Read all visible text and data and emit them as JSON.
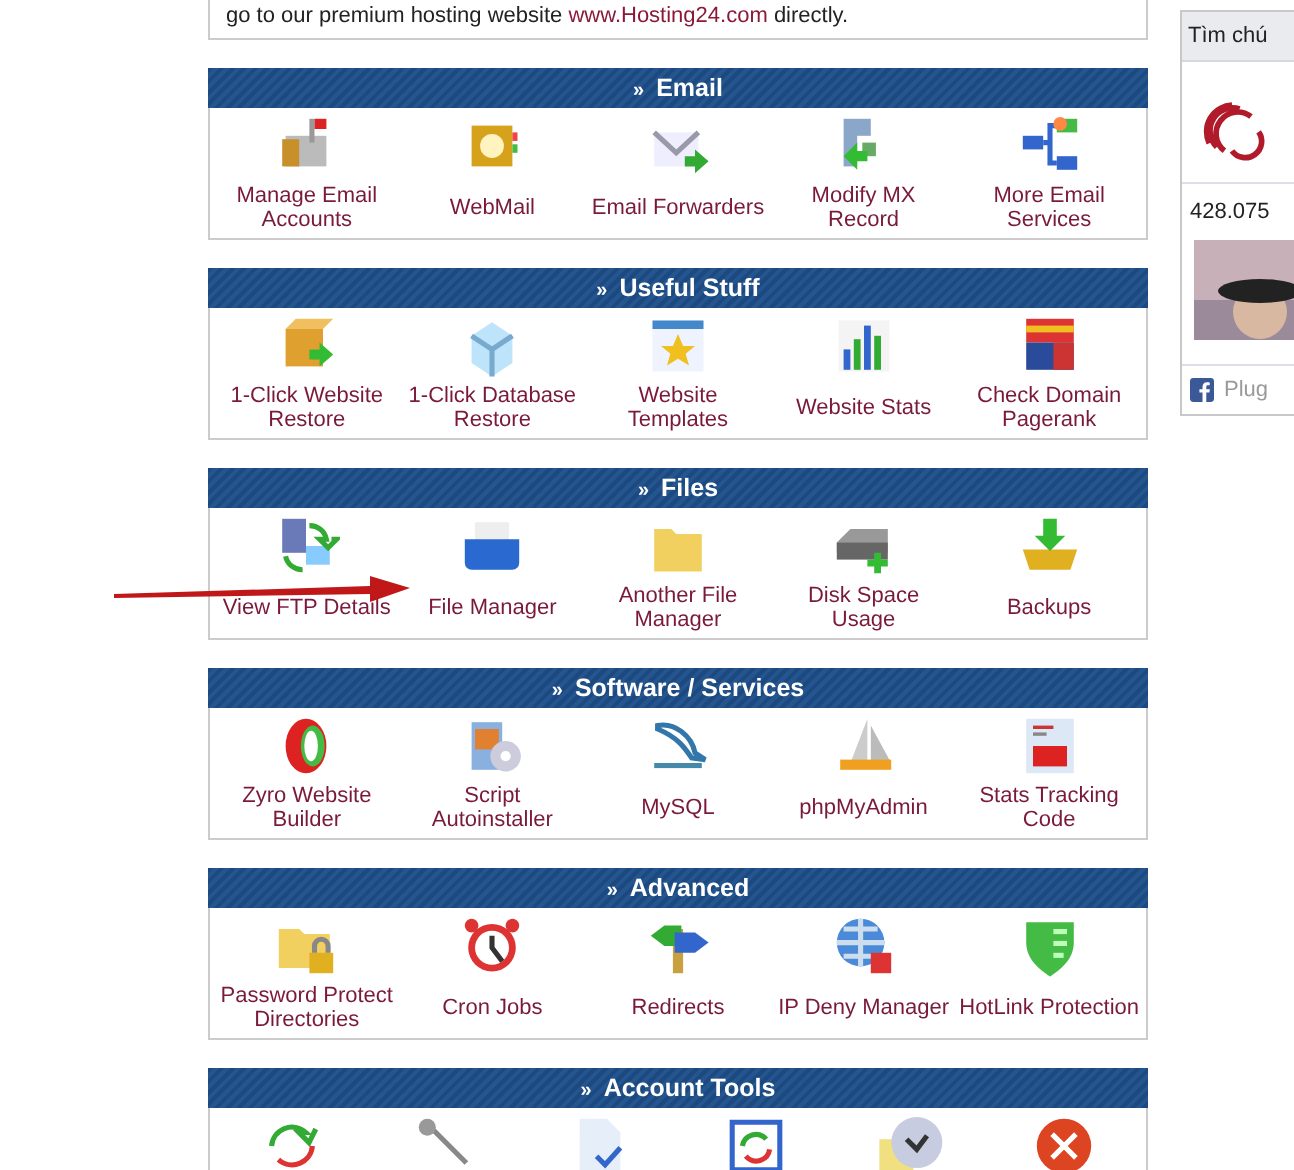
{
  "intro": {
    "text": "go to our premium hosting website",
    "link": "www.Hosting24.com",
    "after": "directly."
  },
  "sections": [
    {
      "marker": "»",
      "title": "Email",
      "items": [
        {
          "kind": "labeled",
          "label": "Manage Email Accounts"
        },
        {
          "kind": "labeled",
          "label": "WebMail"
        },
        {
          "kind": "labeled",
          "label": "Email Forwarders"
        },
        {
          "kind": "labeled",
          "label": "Modify MX Record"
        },
        {
          "kind": "labeled",
          "label": "More Email Services"
        }
      ]
    },
    {
      "marker": "»",
      "title": "Useful Stuff",
      "items": [
        {
          "kind": "labeled",
          "label": "1-Click Website Restore"
        },
        {
          "kind": "labeled",
          "label": "1-Click Database Restore"
        },
        {
          "kind": "labeled",
          "label": "Website Templates"
        },
        {
          "kind": "labeled",
          "label": "Website Stats"
        },
        {
          "kind": "labeled",
          "label": "Check Domain Pagerank"
        }
      ]
    },
    {
      "marker": "»",
      "title": "Files",
      "items": [
        {
          "kind": "labeled",
          "label": "View FTP Details"
        },
        {
          "kind": "labeled",
          "label": "File Manager"
        },
        {
          "kind": "labeled",
          "label": "Another File Manager"
        },
        {
          "kind": "labeled",
          "label": "Disk Space Usage"
        },
        {
          "kind": "labeled",
          "label": "Backups"
        }
      ]
    },
    {
      "marker": "»",
      "title": "Software / Services",
      "items": [
        {
          "kind": "labeled",
          "label": "Zyro Website Builder"
        },
        {
          "kind": "labeled",
          "label": "Script Autoinstaller"
        },
        {
          "kind": "labeled",
          "label": "MySQL"
        },
        {
          "kind": "labeled",
          "label": "phpMyAdmin"
        },
        {
          "kind": "labeled",
          "label": "Stats Tracking Code"
        }
      ]
    },
    {
      "marker": "»",
      "title": "Advanced",
      "items": [
        {
          "kind": "labeled",
          "label": "Password Protect Directories"
        },
        {
          "kind": "labeled",
          "label": "Cron Jobs"
        },
        {
          "kind": "labeled",
          "label": "Redirects"
        },
        {
          "kind": "labeled",
          "label": "IP Deny Manager"
        },
        {
          "kind": "labeled",
          "label": "HotLink Protection"
        }
      ]
    },
    {
      "marker": "»",
      "title": "Account Tools",
      "items": [
        {
          "kind": "icon"
        },
        {
          "kind": "icon"
        },
        {
          "kind": "icon"
        },
        {
          "kind": "icon"
        },
        {
          "kind": "icon"
        },
        {
          "kind": "icon"
        }
      ]
    }
  ],
  "widget": {
    "title": "Tìm chú",
    "count": "428.075",
    "footer": "Plug"
  }
}
